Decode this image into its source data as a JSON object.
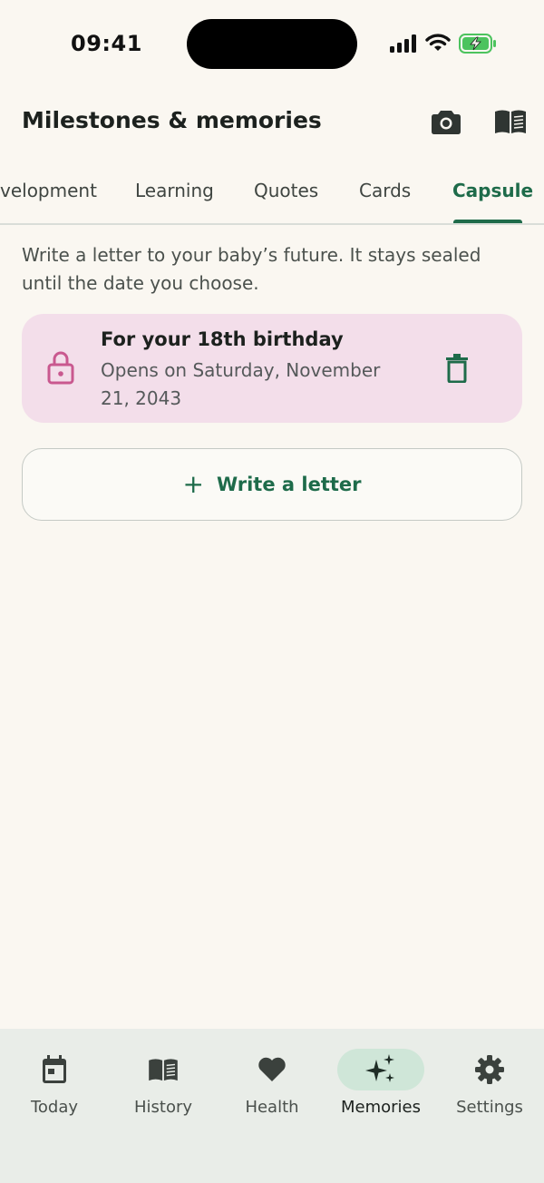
{
  "status_bar": {
    "time": "09:41"
  },
  "header": {
    "title": "Milestones & memories",
    "camera_icon": "camera-icon",
    "book_icon": "book-icon"
  },
  "tabs": [
    {
      "label": "Development",
      "shown": "velopment",
      "active": false
    },
    {
      "label": "Learning",
      "active": false
    },
    {
      "label": "Quotes",
      "active": false
    },
    {
      "label": "Cards",
      "active": false
    },
    {
      "label": "Capsule",
      "active": true
    }
  ],
  "capsule": {
    "intro": "Write a letter to your baby’s future. It stays sealed until the date you choose.",
    "letters": [
      {
        "title": "For your 18th birthday",
        "opens": "Opens on Saturday, November 21, 2043",
        "status_icon": "lock-icon"
      }
    ],
    "write_button": {
      "icon": "plus-icon",
      "label": "Write a letter"
    }
  },
  "bottom_nav": [
    {
      "label": "Today",
      "icon": "calendar-icon",
      "active": false
    },
    {
      "label": "History",
      "icon": "book-icon",
      "active": false
    },
    {
      "label": "Health",
      "icon": "heart-icon",
      "active": false
    },
    {
      "label": "Memories",
      "icon": "sparkle-icon",
      "active": true
    },
    {
      "label": "Settings",
      "icon": "gear-icon",
      "active": false
    }
  ],
  "colors": {
    "background": "#FAF7F1",
    "accent": "#1E6B4A",
    "card_pink": "#F3DEEA",
    "lock_pink": "#C9588F",
    "nav_bg": "#E9EDE8",
    "nav_pill": "#CFE6D8"
  }
}
